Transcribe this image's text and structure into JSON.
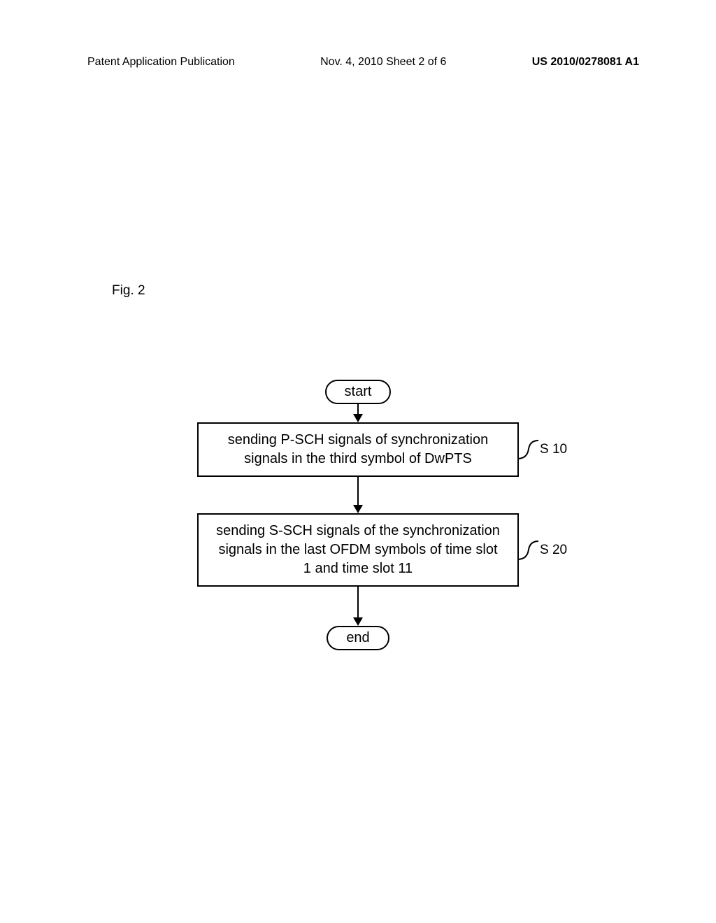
{
  "header": {
    "left": "Patent Application Publication",
    "center": "Nov. 4, 2010  Sheet 2 of 6",
    "right": "US 2010/0278081 A1"
  },
  "figure_label": "Fig. 2",
  "flowchart": {
    "start": "start",
    "step1": {
      "text": "sending P-SCH signals of  synchronization signals in the third symbol of DwPTS",
      "tag": "S 10"
    },
    "step2": {
      "text": "sending S-SCH signals of the synchronization signals in the last OFDM symbols of time slot 1 and time slot 11",
      "tag": "S 20"
    },
    "end": "end"
  }
}
